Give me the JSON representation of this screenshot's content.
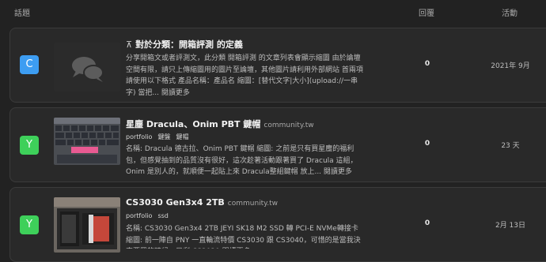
{
  "header": {
    "topic": "話題",
    "replies": "回覆",
    "activity": "活動"
  },
  "topics": [
    {
      "avatar_letter": "C",
      "avatar_color": "#3d9df2",
      "pin_icon": "pin-icon",
      "title": "對於分類：開箱評測 的定義",
      "excerpt": "分享開箱文或者評測文，此分類 開箱評測 的文章列表會顯示縮圖 由於論壇空間有限，請只上傳縮圖用的圖片至論壇，其他圖片請利用外部網站 首兩項請使用以下格式 產品名稱：產品名 縮圖：[替代文字|大小](upload://一串字) 當把...",
      "more": "閱讀更多",
      "replies": "0",
      "activity": "2021年 9月"
    },
    {
      "avatar_letter": "Y",
      "avatar_color": "#3ed05a",
      "title": "星塵 Dracula、Onim PBT 鍵帽",
      "domain": "community.tw",
      "tags": [
        "portfolio",
        "鍵盤",
        "鍵帽"
      ],
      "excerpt": "名稱: Dracula 德古拉、Onim PBT 鍵帽 縮圖: 之前是只有買星塵的福利包，但感覺抽到的品質沒有很好，這次趁著活動跟著買了 Dracula 這組，Onim 是別人的，就順便一起貼上來 Dracula整組鍵帽 放上...",
      "more": "閱讀更多",
      "replies": "0",
      "activity": "23 天"
    },
    {
      "avatar_letter": "Y",
      "avatar_color": "#3ed05a",
      "title": "CS3030 Gen3x4 2TB",
      "domain": "community.tw",
      "tags": [
        "portfolio",
        "ssd"
      ],
      "excerpt": "名稱: CS3030 Gen3x4 2TB JEYI SK18 M2 SSD 轉 PCI-E NVMe轉接卡 縮圖: 前一陣自 PNY 一直輪流特價 CS3030 跟 CS3040，可惜的是當我決定要買的時候，只剩 CS3030 閱讀更多",
      "more": "",
      "replies": "0",
      "activity": "2月 13日"
    }
  ]
}
